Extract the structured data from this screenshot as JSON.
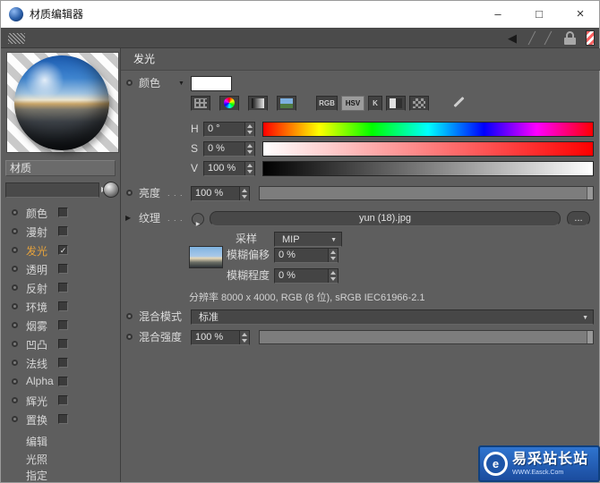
{
  "window": {
    "title": "材质编辑器",
    "controls": {
      "minimize": "–",
      "maximize": "□",
      "close": "×"
    }
  },
  "toolbar": {
    "icons": {
      "back": "◀",
      "slash": "╱"
    }
  },
  "sidebar": {
    "material_label": "材质",
    "channels": [
      {
        "label": "颜色",
        "checked": false
      },
      {
        "label": "漫射",
        "checked": false
      },
      {
        "label": "发光",
        "checked": true,
        "active": true
      },
      {
        "label": "透明",
        "checked": false
      },
      {
        "label": "反射",
        "checked": false
      },
      {
        "label": "环境",
        "checked": false
      },
      {
        "label": "烟雾",
        "checked": false
      },
      {
        "label": "凹凸",
        "checked": false
      },
      {
        "label": "法线",
        "checked": false
      },
      {
        "label": "Alpha",
        "checked": false
      },
      {
        "label": "辉光",
        "checked": false
      },
      {
        "label": "置换",
        "checked": false
      }
    ],
    "modes": [
      {
        "label": "编辑"
      },
      {
        "label": "光照"
      },
      {
        "label": "指定"
      }
    ]
  },
  "panel": {
    "header": "发光",
    "color_label": "颜色",
    "swatch_color": "#ffffff",
    "mode_buttons": {
      "rgb": "RGB",
      "hsv": "HSV",
      "k": "K"
    },
    "h": {
      "label": "H",
      "value": "0 °"
    },
    "s": {
      "label": "S",
      "value": "0 %"
    },
    "v": {
      "label": "V",
      "value": "100 %"
    },
    "brightness": {
      "label": "亮度",
      "value": "100 %"
    },
    "texture": {
      "label": "纹理",
      "file": "yun (18).jpg",
      "more": "..."
    },
    "sampling": {
      "label": "采样",
      "value": "MIP"
    },
    "blur_offset": {
      "label": "模糊偏移",
      "value": "0 %"
    },
    "blur_strength": {
      "label": "模糊程度",
      "value": "0 %"
    },
    "resolution": "分辨率 8000 x 4000, RGB (8 位), sRGB IEC61966-2.1",
    "mix_mode": {
      "label": "混合模式",
      "value": "标准"
    },
    "mix_strength": {
      "label": "混合强度",
      "value": "100 %"
    }
  },
  "glyphs": {
    "check": "✓",
    "down": "▼",
    "right": "▶",
    "leader": ". . ."
  },
  "watermark": {
    "title": "易采站长站",
    "subtitle": "WWW.Easck.Com"
  },
  "colors": {
    "active_channel": "#e6a23c",
    "accent_blue": "#1d55a8"
  }
}
